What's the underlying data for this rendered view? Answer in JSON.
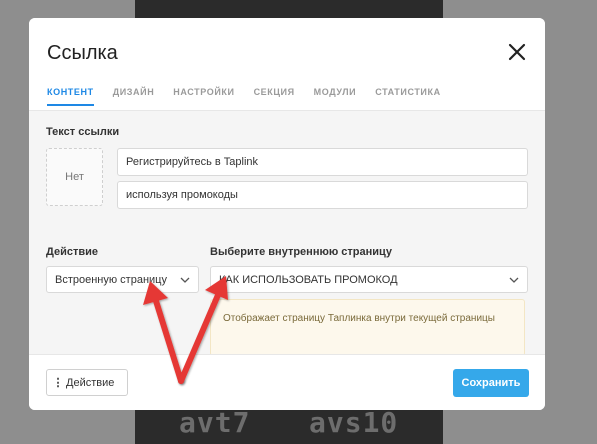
{
  "background": {
    "text_left": "avt7",
    "text_right": "avs10"
  },
  "dialog": {
    "title": "Ссылка",
    "close_icon": "close-icon",
    "tabs": [
      {
        "label": "КОНТЕНТ",
        "active": true
      },
      {
        "label": "ДИЗАЙН",
        "active": false
      },
      {
        "label": "НАСТРОЙКИ",
        "active": false
      },
      {
        "label": "СЕКЦИЯ",
        "active": false
      },
      {
        "label": "МОДУЛИ",
        "active": false
      },
      {
        "label": "СТАТИСТИКА",
        "active": false
      }
    ]
  },
  "content": {
    "link_text_label": "Текст ссылки",
    "image_placeholder": "Нет",
    "title_value": "Регистрируйтесь в Taplink",
    "subtitle_value": "используя промокоды",
    "action_label": "Действие",
    "action_value": "Встроенную страницу",
    "page_label": "Выберите внутреннюю страницу",
    "page_value": "КАК ИСПОЛЬЗОВАТЬ ПРОМОКОД",
    "hint": "Отображает страницу Таплинка внутри текущей страницы"
  },
  "footer": {
    "action_button": "Действие",
    "save_button": "Сохранить"
  },
  "colors": {
    "accent": "#1e88e5",
    "save": "#35a8ea",
    "annotation_arrow": "#e53935"
  }
}
